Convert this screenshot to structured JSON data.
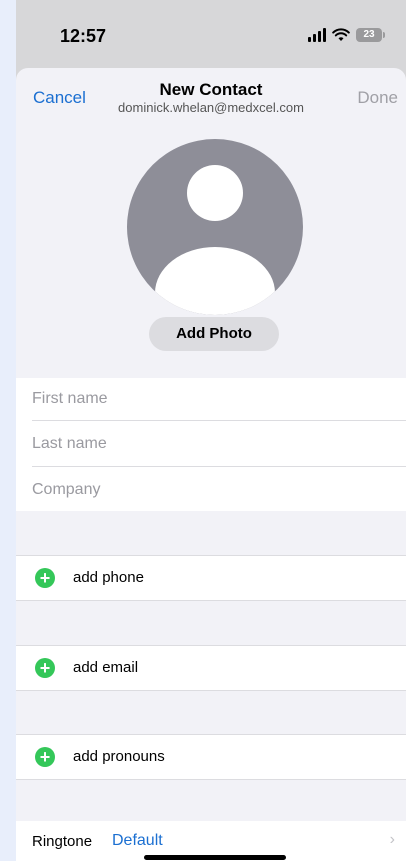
{
  "status": {
    "time": "12:57",
    "battery": "23"
  },
  "nav": {
    "cancel_label": "Cancel",
    "title": "New Contact",
    "subtitle": "dominick.whelan@medxcel.com",
    "done_label": "Done"
  },
  "photo": {
    "add_photo_label": "Add Photo"
  },
  "fields": {
    "first_name_placeholder": "First name",
    "last_name_placeholder": "Last name",
    "company_placeholder": "Company"
  },
  "actions": {
    "add_phone": "add phone",
    "add_email": "add email",
    "add_pronouns": "add pronouns"
  },
  "ringtone": {
    "label": "Ringtone",
    "value": "Default"
  },
  "icons": {
    "plus": "+",
    "chevron": "›"
  },
  "colors": {
    "accent": "#1b6fd1",
    "add_green": "#34c759",
    "avatar_gray": "#8e8e98"
  }
}
